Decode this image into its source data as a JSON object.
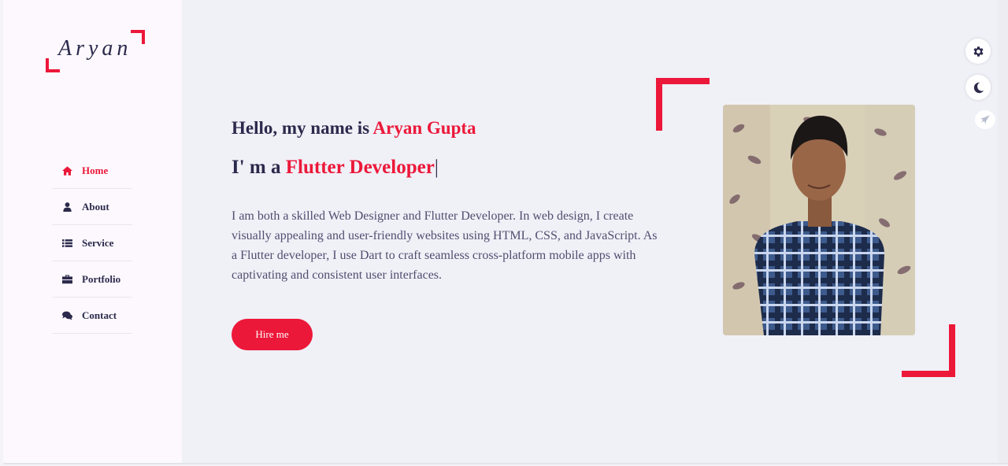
{
  "logo": {
    "text": "Aryan"
  },
  "nav": {
    "items": [
      {
        "label": "Home",
        "icon": "home-icon",
        "active": true
      },
      {
        "label": "About",
        "icon": "user-icon",
        "active": false
      },
      {
        "label": "Service",
        "icon": "list-icon",
        "active": false
      },
      {
        "label": "Portfolio",
        "icon": "briefcase-icon",
        "active": false
      },
      {
        "label": "Contact",
        "icon": "comments-icon",
        "active": false
      }
    ]
  },
  "hero": {
    "greeting_prefix": "Hello, my name is ",
    "name": "Aryan Gupta",
    "role_prefix": "I' m a ",
    "role": "Flutter Developer",
    "cursor": "|",
    "bio": "I am both a skilled Web Designer and Flutter Developer. In web design, I create visually appealing and user-friendly websites using HTML, CSS, and JavaScript. As a Flutter developer, I use Dart to craft seamless cross-platform mobile apps with captivating and consistent user interfaces.",
    "hire_label": "Hire me",
    "photo_alt": "Aryan Gupta"
  },
  "controls": {
    "settings_icon": "gear-icon",
    "theme_icon": "moon-icon",
    "extra_icon": "rocket-icon"
  },
  "colors": {
    "accent": "#ec1839",
    "text": "#2b2a4c",
    "sidebar_bg": "#fdf8fd",
    "main_bg": "#f0f0f7"
  }
}
